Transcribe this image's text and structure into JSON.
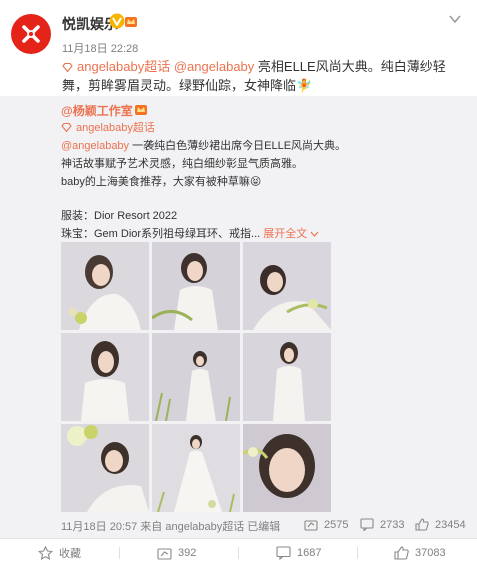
{
  "post": {
    "author": "悦凯娱乐",
    "timestamp": "11月18日 22:28",
    "text_topic": "angelababy超话",
    "text_mention": "@angelababy",
    "text_part1": " 亮相ELLE风尚大典。纯白薄纱轻舞，剪眸雾眉灵动。绿野仙踪，女神降临",
    "emoji": "🧚"
  },
  "repost": {
    "author": "@杨颖工作室",
    "topic": "angelababy超话",
    "mention": "@angelababy",
    "line1": " 一袭纯白色薄纱裙出席今日ELLE风尚大典。",
    "line2": "神话故事赋予艺术灵感，纯白细纱彰显气质高雅。",
    "line3": "baby的上海美食推荐，大家有被种草嘛",
    "line3_emoji": "😝",
    "line4": "服装：Dior Resort 2022",
    "line5": "珠宝：Gem Dior系列祖母绿耳环、戒指...",
    "expand": "展开全文",
    "footer_meta": "11月18日 20:57 来自 angelababy超话  已编辑",
    "stats": {
      "reposts": "2575",
      "comments": "2733",
      "likes": "23454"
    }
  },
  "actions": {
    "favorite": "收藏",
    "repost": "392",
    "comment": "1687",
    "like": "37083"
  },
  "photos": [
    {
      "name": "photo-1"
    },
    {
      "name": "photo-2"
    },
    {
      "name": "photo-3"
    },
    {
      "name": "photo-4"
    },
    {
      "name": "photo-5"
    },
    {
      "name": "photo-6"
    },
    {
      "name": "photo-7"
    },
    {
      "name": "photo-8"
    },
    {
      "name": "photo-9"
    }
  ],
  "colors": {
    "link": "#eb7350",
    "brand": "#e42319",
    "repost_bg": "#f2f2f5"
  }
}
